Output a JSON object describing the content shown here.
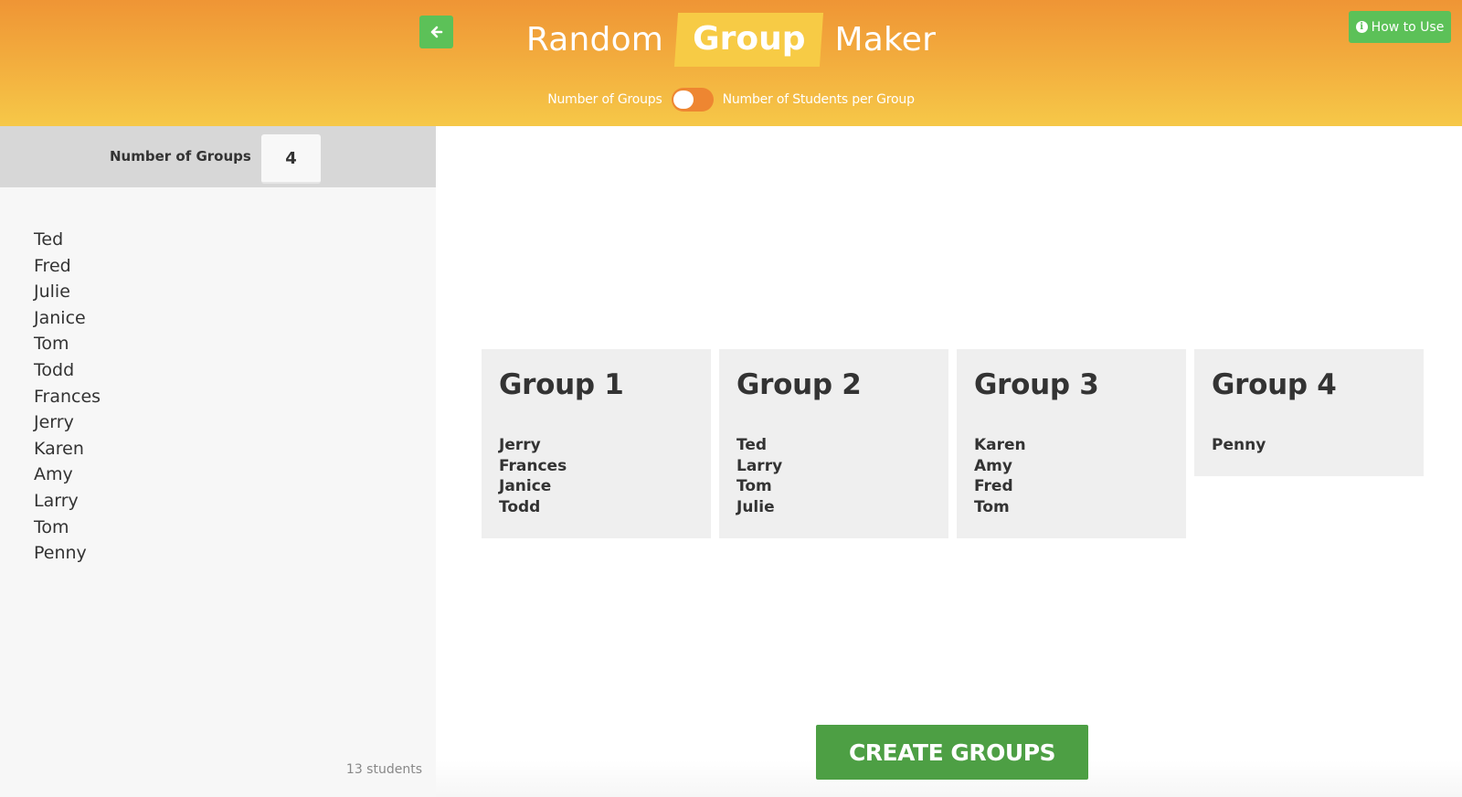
{
  "header": {
    "title_part1": "Random",
    "title_highlight": "Group",
    "title_part2": "Maker",
    "toggle_left_label": "Number of Groups",
    "toggle_right_label": "Number of Students per Group",
    "toggle_state": "Number of Groups",
    "how_to_use_label": "How to Use",
    "how_to_use_icon": "info-circle-icon"
  },
  "sidebar": {
    "mode_label": "Number of Groups",
    "mode_value": "4",
    "collapse_icon": "arrow-left-icon",
    "students": [
      "Ted",
      "Fred",
      "Julie",
      "Janice",
      "Tom",
      "Todd",
      "Frances",
      "Jerry",
      "Karen",
      "Amy",
      "Larry",
      "Tom",
      "Penny"
    ],
    "student_count": "13 students"
  },
  "groups": [
    {
      "title": "Group 1",
      "members": [
        "Jerry",
        "Frances",
        "Janice",
        "Todd"
      ]
    },
    {
      "title": "Group 2",
      "members": [
        "Ted",
        "Larry",
        "Tom",
        "Julie"
      ]
    },
    {
      "title": "Group 3",
      "members": [
        "Karen",
        "Amy",
        "Fred",
        "Tom"
      ]
    },
    {
      "title": "Group 4",
      "members": [
        "Penny"
      ]
    }
  ],
  "actions": {
    "create_groups_label": "CREATE GROUPS"
  },
  "colors": {
    "header_gradient_start": "#ef9535",
    "header_gradient_end": "#f6c848",
    "title_highlight": "#f7cb45",
    "toggle_track": "#ee8631",
    "accent_green": "#5cc158",
    "create_button_green": "#4d9f44",
    "group_card_bg": "#efefef"
  }
}
